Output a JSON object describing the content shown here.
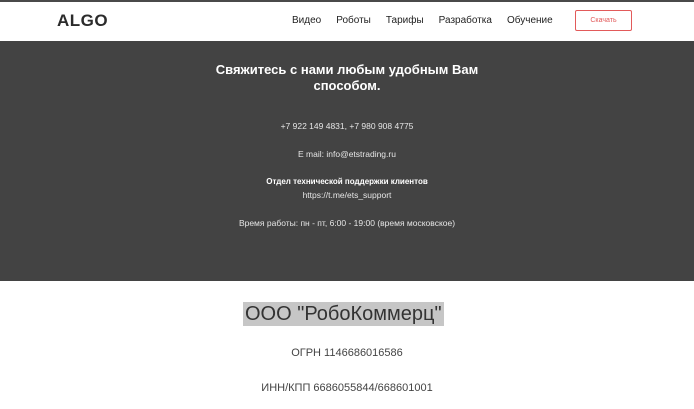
{
  "header": {
    "logo": "ALGO",
    "nav": [
      "Видео",
      "Роботы",
      "Тарифы",
      "Разработка",
      "Обучение"
    ],
    "download_button": "Скачать"
  },
  "contact": {
    "title_line1": "Свяжитесь с нами любым удобным Вам",
    "title_line2": "способом.",
    "phones": "+7 922 149 4831, +7 980 908 4775",
    "email": "E mail: info@etstrading.ru",
    "support_heading": "Отдел технической поддержки клиентов",
    "support_link": "https://t.me/ets_support",
    "hours": "Время работы: пн - пт, 6:00 - 19:00 (время московское)"
  },
  "company": {
    "name": "ООО \"РобоКоммерц\"",
    "ogrn": "ОГРН 1146686016586",
    "inn_kpp": "ИНН/КПП 6686055844/668601001"
  }
}
